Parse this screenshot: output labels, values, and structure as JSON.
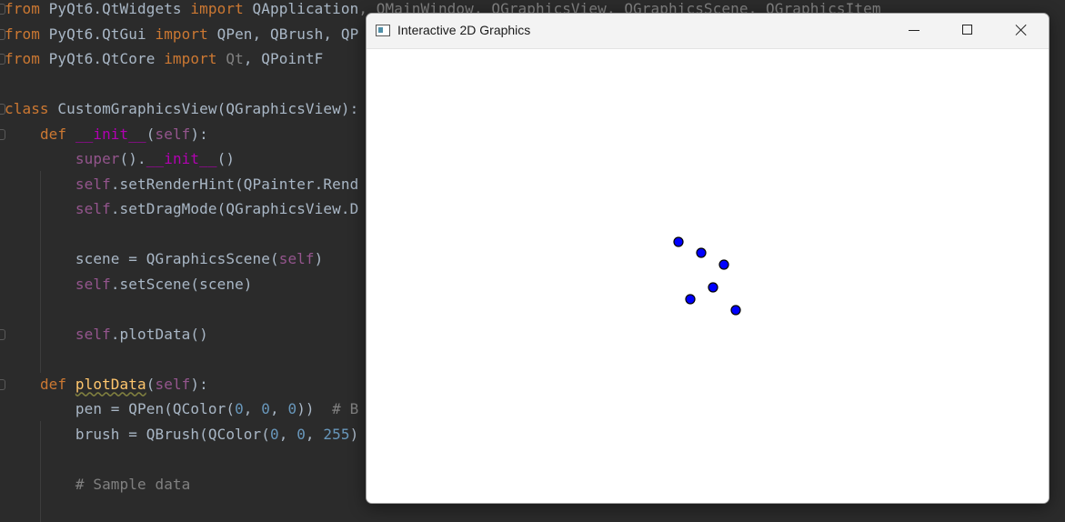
{
  "editor": {
    "lines": [
      [
        [
          "kw",
          "from "
        ],
        [
          "t",
          "PyQt6.QtWidgets "
        ],
        [
          "kw",
          "import "
        ],
        [
          "t",
          "QApplication"
        ],
        [
          "dim",
          ", QMainWindow, QGraphicsView, QGraphicsScene, QGraphicsItem"
        ]
      ],
      [
        [
          "kw",
          "from "
        ],
        [
          "t",
          "PyQt6.QtGui "
        ],
        [
          "kw",
          "import "
        ],
        [
          "t",
          "QPen, QBrush, QP"
        ]
      ],
      [
        [
          "kw",
          "from "
        ],
        [
          "t",
          "PyQt6.QtCore "
        ],
        [
          "kw",
          "import "
        ],
        [
          "dim",
          "Qt"
        ],
        [
          "t",
          ", QPointF"
        ]
      ],
      [],
      [
        [
          "kw",
          "class "
        ],
        [
          "t",
          "CustomGraphicsView(QGraphicsView):"
        ]
      ],
      [
        [
          "t",
          "    "
        ],
        [
          "kw",
          "def "
        ],
        [
          "dunder",
          "__init__"
        ],
        [
          "t",
          "("
        ],
        [
          "self",
          "self"
        ],
        [
          "t",
          "):"
        ]
      ],
      [
        [
          "t",
          "        "
        ],
        [
          "self",
          "super"
        ],
        [
          "t",
          "()."
        ],
        [
          "dunder",
          "__init__"
        ],
        [
          "t",
          "()"
        ]
      ],
      [
        [
          "t",
          "        "
        ],
        [
          "self",
          "self"
        ],
        [
          "t",
          ".setRenderHint(QPainter.Rend"
        ]
      ],
      [
        [
          "t",
          "        "
        ],
        [
          "self",
          "self"
        ],
        [
          "t",
          ".setDragMode(QGraphicsView.D"
        ]
      ],
      [],
      [
        [
          "t",
          "        scene = QGraphicsScene("
        ],
        [
          "self",
          "self"
        ],
        [
          "t",
          ")"
        ]
      ],
      [
        [
          "t",
          "        "
        ],
        [
          "self",
          "self"
        ],
        [
          "t",
          ".setScene(scene)"
        ]
      ],
      [],
      [
        [
          "t",
          "        "
        ],
        [
          "self",
          "self"
        ],
        [
          "t",
          ".plotData()"
        ]
      ],
      [],
      [
        [
          "t",
          "    "
        ],
        [
          "kw",
          "def "
        ],
        [
          "fnu",
          "plotData"
        ],
        [
          "t",
          "("
        ],
        [
          "self",
          "self"
        ],
        [
          "t",
          "):"
        ]
      ],
      [
        [
          "t",
          "        pen = QPen(QColor("
        ],
        [
          "num",
          "0"
        ],
        [
          "t",
          ", "
        ],
        [
          "num",
          "0"
        ],
        [
          "t",
          ", "
        ],
        [
          "num",
          "0"
        ],
        [
          "t",
          "))  "
        ],
        [
          "cm",
          "# B"
        ]
      ],
      [
        [
          "t",
          "        brush = QBrush(QColor("
        ],
        [
          "num",
          "0"
        ],
        [
          "t",
          ", "
        ],
        [
          "num",
          "0"
        ],
        [
          "t",
          ", "
        ],
        [
          "num",
          "255"
        ],
        [
          "t",
          ")"
        ]
      ],
      [],
      [
        [
          "t",
          "        "
        ],
        [
          "cm",
          "# Sample data"
        ]
      ]
    ]
  },
  "window": {
    "title": "Interactive 2D Graphics",
    "point_fill": "#0000ff",
    "point_stroke": "#000000"
  }
}
